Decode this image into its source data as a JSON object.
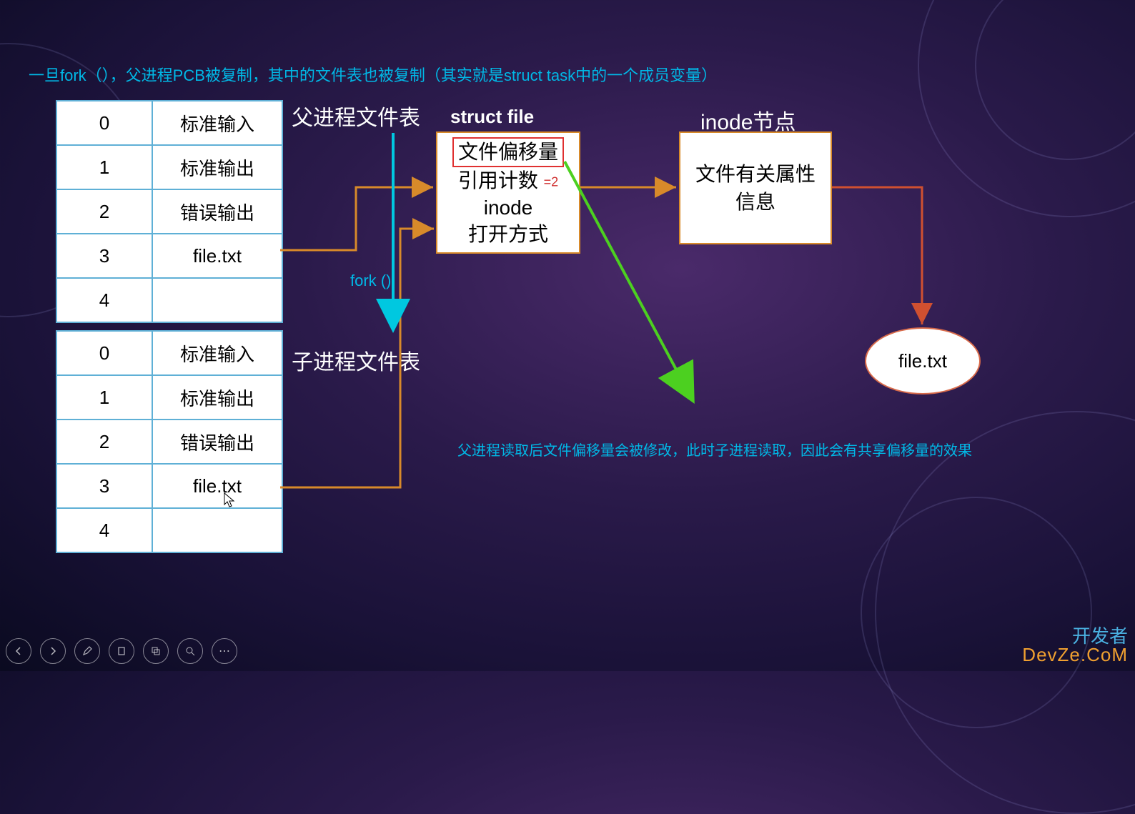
{
  "top_note": "一旦fork（），父进程PCB被复制，其中的文件表也被复制（其实就是struct task中的一个成员变量）",
  "labels": {
    "parent_table_title": "父进程文件表",
    "child_table_title": "子进程文件表",
    "struct_file": "struct file",
    "inode_title": "inode节点",
    "fork_call": "fork ()"
  },
  "parent_table": [
    {
      "idx": "0",
      "val": "标准输入"
    },
    {
      "idx": "1",
      "val": "标准输出"
    },
    {
      "idx": "2",
      "val": "错误输出"
    },
    {
      "idx": "3",
      "val": "file.txt"
    },
    {
      "idx": "4",
      "val": ""
    }
  ],
  "child_table": [
    {
      "idx": "0",
      "val": "标准输入"
    },
    {
      "idx": "1",
      "val": "标准输出"
    },
    {
      "idx": "2",
      "val": "错误输出"
    },
    {
      "idx": "3",
      "val": "file.txt"
    },
    {
      "idx": "4",
      "val": ""
    }
  ],
  "struct_file_box": {
    "line1": "文件偏移量",
    "line2_label": "引用计数",
    "line2_count": "=2",
    "line3": "inode",
    "line4": "打开方式"
  },
  "inode_box": "文件有关属性\n信息",
  "file_ellipse": "file.txt",
  "bottom_note": "父进程读取后文件偏移量会被修改，此时子进程读取，因此会有共享偏移量的效果",
  "watermark": {
    "l1": "开发者",
    "l2": "DevZe.CoM"
  },
  "toolbar": [
    "prev",
    "play",
    "pen",
    "highlighter",
    "copy",
    "zoom",
    "more"
  ]
}
